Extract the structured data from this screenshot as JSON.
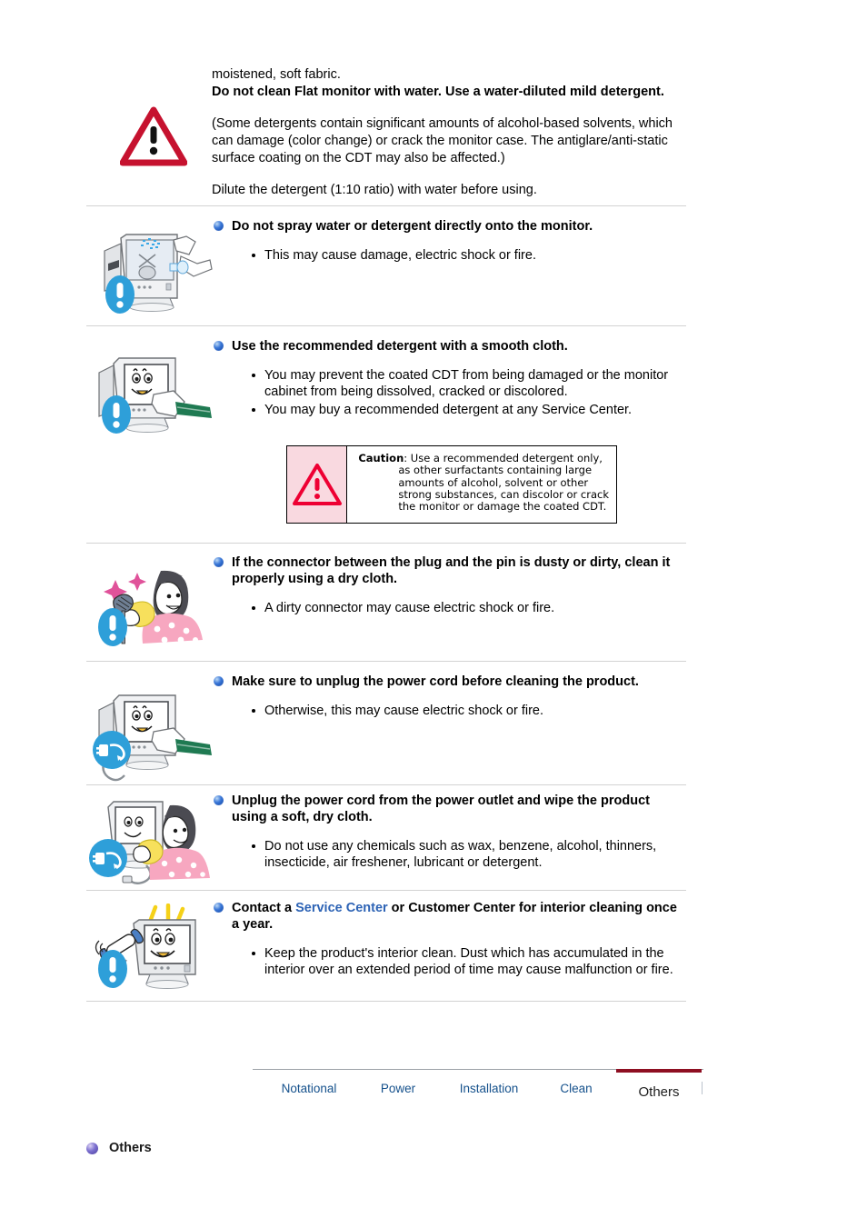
{
  "intro": {
    "line1": "moistened, soft fabric.",
    "line2_bold": "Do not clean Flat monitor with water. Use a water-diluted mild detergent.",
    "paragraph2": "(Some detergents contain significant amounts of alcohol-based solvents, which can damage (color change) or crack the monitor case. The antiglare/anti-static surface coating on the CDT may also be affected.)",
    "paragraph3": "Dilute the detergent (1:10 ratio) with water before using.",
    "warning_icon": "warning-triangle-icon"
  },
  "sections": [
    {
      "id": "no-spray",
      "heading": "Do not spray water or detergent directly onto the monitor.",
      "bullets": [
        "This may cause damage, electric shock or fire."
      ],
      "illustration": "monitor-spray-bottle-illustration",
      "badge": "blue-exclamation-badge"
    },
    {
      "id": "recommended-detergent",
      "heading": "Use the recommended detergent with a smooth cloth.",
      "bullets": [
        "You may prevent the coated CDT from being damaged or the monitor cabinet from being dissolved, cracked or discolored.",
        "You may buy a recommended detergent at any Service Center."
      ],
      "illustration": "monitor-wiping-cloth-illustration",
      "badge": "blue-exclamation-badge"
    },
    {
      "id": "dirty-connector",
      "heading": "If the connector between the plug and the pin is dusty or dirty, clean it properly using a dry cloth.",
      "bullets": [
        "A dirty connector may cause electric shock or fire."
      ],
      "illustration": "woman-cleaning-plug-illustration",
      "badge": "blue-exclamation-badge"
    },
    {
      "id": "unplug-before-cleaning",
      "heading": "Make sure to unplug the power cord before cleaning the product.",
      "bullets": [
        "Otherwise, this may cause electric shock or fire."
      ],
      "illustration": "monitor-unplug-illustration",
      "badge": "blue-unplug-badge"
    },
    {
      "id": "unplug-and-wipe",
      "heading": "Unplug the power cord from the power outlet and wipe the product using a soft, dry cloth.",
      "bullets": [
        "Do not use any chemicals such as wax, benzene, alcohol, thinners, insecticide, air freshener, lubricant or detergent."
      ],
      "illustration": "woman-wiping-monitor-illustration",
      "badge": "blue-unplug-badge"
    },
    {
      "id": "service-center-interior",
      "heading_before_link": "Contact a ",
      "heading_link": "Service Center",
      "heading_after_link": " or Customer Center for interior cleaning once a year.",
      "bullets": [
        "Keep the product's interior clean. Dust which has accumulated in the interior over an extended period of time may cause malfunction or fire."
      ],
      "illustration": "phone-call-monitor-illustration",
      "badge": "blue-exclamation-badge"
    }
  ],
  "caution_box": {
    "icon": "caution-triangle-icon",
    "title": "Caution",
    "colon": ":",
    "lines": [
      "Use a recommended detergent only,",
      "as other surfactants containing large",
      "amounts of alcohol, solvent or other",
      "strong substances, can discolor or crack",
      "the monitor or damage the coated CDT."
    ]
  },
  "tabs": {
    "items": [
      {
        "label": "Notational",
        "active": false
      },
      {
        "label": "Power",
        "active": false
      },
      {
        "label": "Installation",
        "active": false
      },
      {
        "label": "Clean",
        "active": false
      },
      {
        "label": "Others",
        "active": true
      }
    ],
    "active_color": "#8e0f22",
    "link_color": "#15518c"
  },
  "footer": {
    "bullet_icon": "purple-sphere-bullet-icon",
    "label": "Others"
  }
}
